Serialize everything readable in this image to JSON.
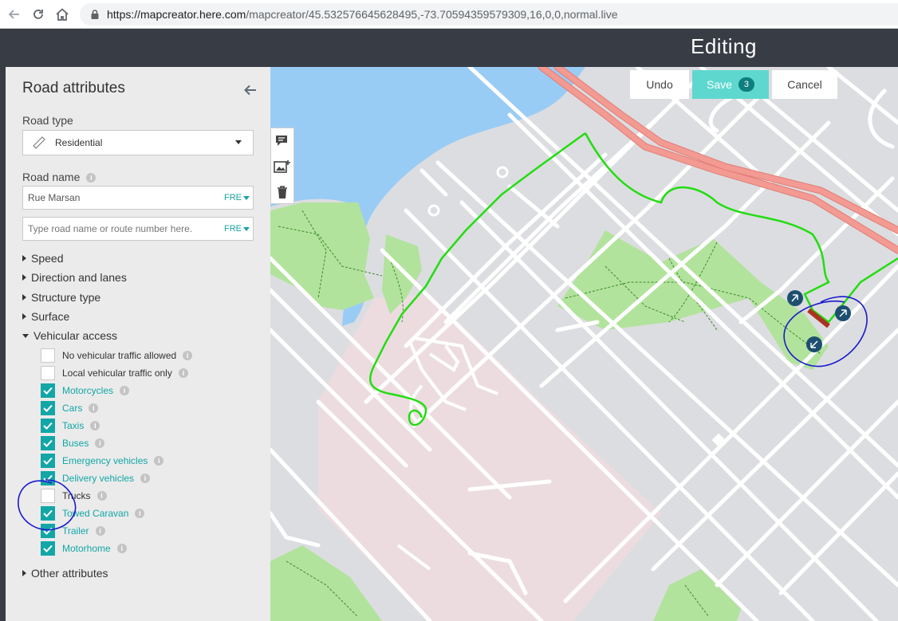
{
  "browser": {
    "url_host": "https://mapcreator.here.com",
    "url_path": "/mapcreator/45.532576645628495,-73.70594359579309,16,0,0,normal.live"
  },
  "app": {
    "title": "Editing"
  },
  "actions": {
    "undo": "Undo",
    "save": "Save",
    "save_count": "3",
    "cancel": "Cancel"
  },
  "panel": {
    "title": "Road attributes",
    "road_type_label": "Road type",
    "road_type_value": "Residential",
    "road_name_label": "Road name",
    "road_name_value": "Rue Marsan",
    "road_name_lang": "FRE",
    "road_name2_placeholder": "Type road name or route number here.",
    "road_name2_lang": "FRE",
    "sections": {
      "speed": "Speed",
      "direction": "Direction and lanes",
      "structure": "Structure type",
      "surface": "Surface",
      "vehicular": "Vehicular access",
      "other": "Other attributes"
    },
    "vehicular_access": [
      {
        "label": "No vehicular traffic allowed",
        "checked": false
      },
      {
        "label": "Local vehicular traffic only",
        "checked": false
      },
      {
        "label": "Motorcycles",
        "checked": true
      },
      {
        "label": "Cars",
        "checked": true
      },
      {
        "label": "Taxis",
        "checked": true
      },
      {
        "label": "Buses",
        "checked": true
      },
      {
        "label": "Emergency vehicles",
        "checked": true
      },
      {
        "label": "Delivery vehicles",
        "checked": true
      },
      {
        "label": "Trucks",
        "checked": false
      },
      {
        "label": "Towed Caravan",
        "checked": true
      },
      {
        "label": "Trailer",
        "checked": true
      },
      {
        "label": "Motorhome",
        "checked": true
      }
    ]
  },
  "colors": {
    "accent": "#13a6a6",
    "header": "#383c45",
    "save": "#5ed8cf",
    "route": "#22dd11",
    "annotation": "#1a1acc",
    "water": "#99ccf5",
    "park": "#b2e39c",
    "zone": "#ecdce0",
    "highway": "#f39a92"
  }
}
